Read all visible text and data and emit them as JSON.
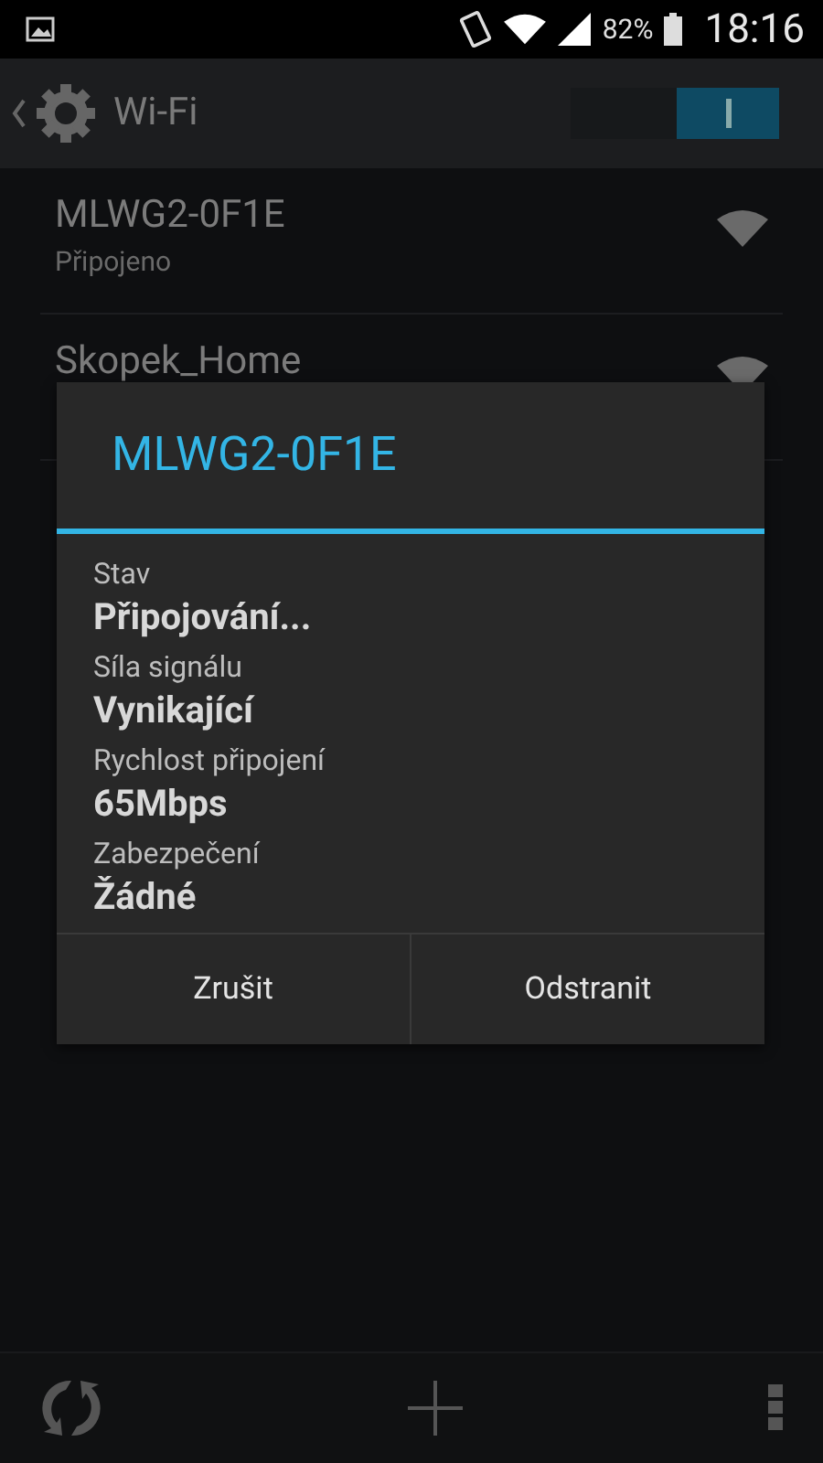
{
  "status_bar": {
    "battery": "82%",
    "time": "18:16"
  },
  "action_bar": {
    "title": "Wi-Fi",
    "wifi_switch": {
      "on": true
    }
  },
  "networks": [
    {
      "name": "MLWG2-0F1E",
      "status": "Připojeno"
    },
    {
      "name": "Skopek_Home"
    }
  ],
  "dialog": {
    "title": "MLWG2-0F1E",
    "fields": [
      {
        "label": "Stav",
        "value": "Připojování..."
      },
      {
        "label": "Síla signálu",
        "value": "Vynikající"
      },
      {
        "label": "Rychlost připojení",
        "value": "65Mbps"
      },
      {
        "label": "Zabezpečení",
        "value": "Žádné"
      }
    ],
    "buttons": [
      "Zrušit",
      "Odstranit"
    ]
  }
}
